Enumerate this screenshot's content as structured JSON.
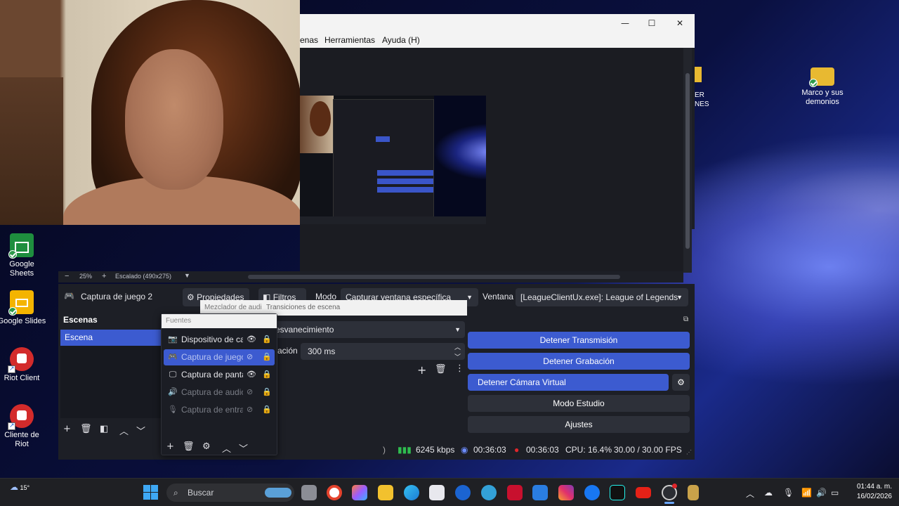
{
  "desktop": {
    "icons_left": [
      {
        "label": "Google Sheets"
      },
      {
        "label": "Google Slides"
      },
      {
        "label": "Riot Client"
      },
      {
        "label": "Cliente de Riot"
      }
    ],
    "icon_right": {
      "label": "Marco y sus demonios"
    },
    "partial_label": "ER\nNES"
  },
  "obs": {
    "menu": [
      "enas",
      "Herramientas",
      "Ayuda (H)"
    ],
    "window_controls": {
      "minimize": "—",
      "maximize": "☐",
      "close": "✕"
    },
    "zoom": {
      "minus": "−",
      "percent": "25%",
      "plus": "+",
      "scale": "Escalado (490x275)"
    },
    "source_toolbar": {
      "source_name": "Captura de juego 2",
      "properties": "Propiedades",
      "filters": "Filtros",
      "mode_label": "Modo",
      "mode_value": "Capturar ventana específica",
      "window_label": "Ventana",
      "window_value": "[LeagueClientUx.exe]: League of Legends"
    },
    "scenes": {
      "title": "Escenas",
      "items": [
        "Escena"
      ]
    },
    "transitions": {
      "tab_mixer": "Mezclador de audi",
      "tab_transitions": "Transiciones de escena",
      "type": "esvanecimiento",
      "duration_label": "ación",
      "duration_value": "300 ms"
    },
    "sources": {
      "title": "Fuentes",
      "items": [
        {
          "name": "Dispositivo de cap",
          "visible": true
        },
        {
          "name": "Captura de juego",
          "visible": false,
          "selected": true
        },
        {
          "name": "Captura de panta",
          "visible": true
        },
        {
          "name": "Captura de audio",
          "visible": false
        },
        {
          "name": "Captura de entrac",
          "visible": false
        }
      ]
    },
    "controls": {
      "stop_stream": "Detener Transmisión",
      "stop_record": "Detener Grabación",
      "stop_virtualcam": "Detener Cámara Virtual",
      "studio_mode": "Modo Estudio",
      "settings": "Ajustes"
    },
    "status": {
      "bitrate": "6245 kbps",
      "stream_time": "00:36:03",
      "record_time": "00:36:03",
      "cpu": "CPU: 16.4%",
      "fps": "30.00 / 30.00 FPS"
    }
  },
  "taskbar": {
    "weather": "15°",
    "search_placeholder": "Buscar",
    "time": "01:44 a. m.",
    "date": "16/02/2026"
  },
  "colors": {
    "accent": "#3c5bd0",
    "panel": "#1d1f26",
    "recording_red": "#e0262b"
  }
}
